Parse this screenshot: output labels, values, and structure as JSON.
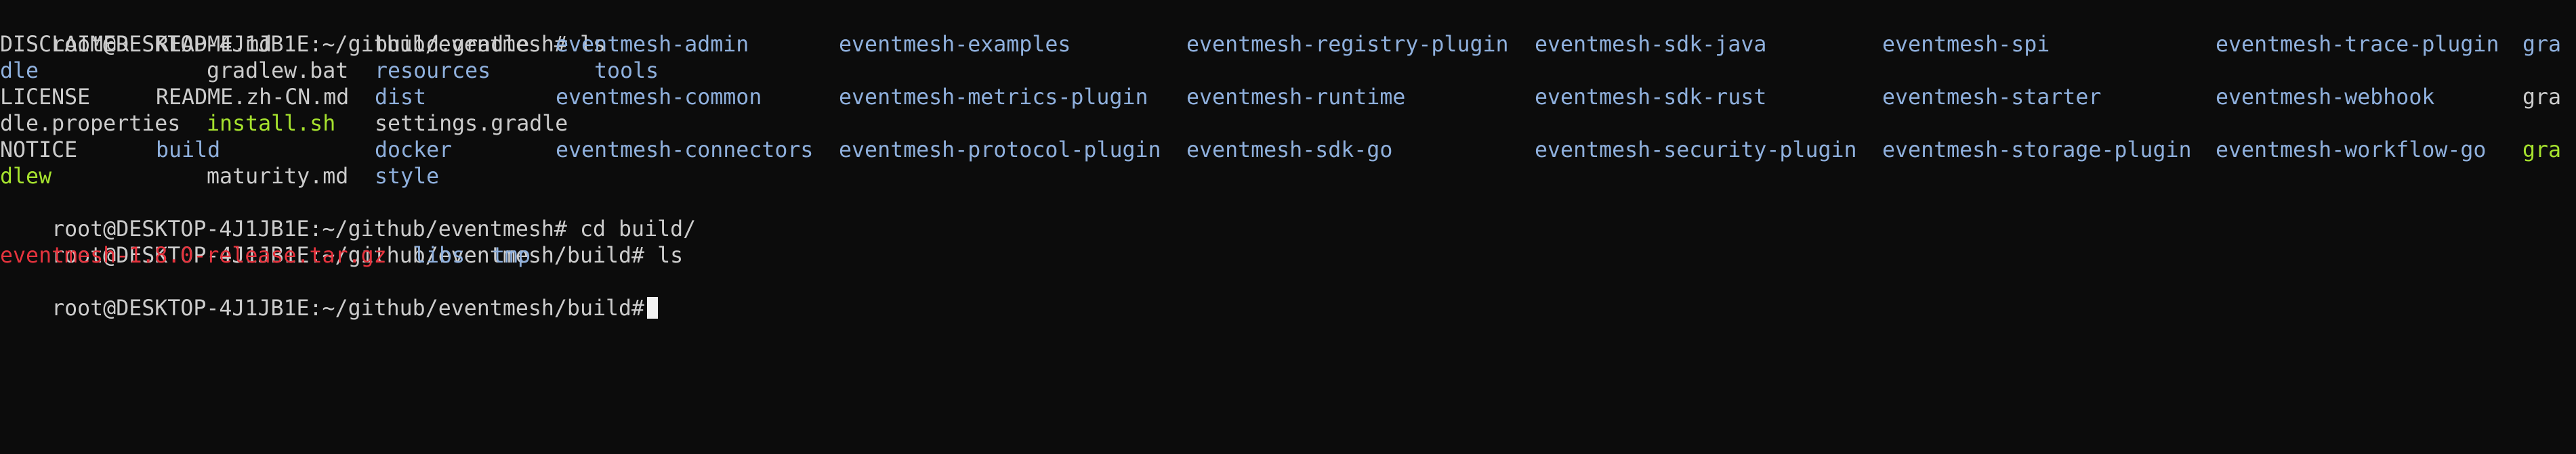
{
  "prompt_text": "root@DESKTOP-4J1JB1E:~/github/eventmesh#",
  "prompt_build": "root@DESKTOP-4J1JB1E:~/github/eventmesh/build#",
  "cmd_ls": " ls",
  "cmd_cd": " cd build/",
  "colors": {
    "background": "#0c0c0c",
    "plain": "#cccccc",
    "directory": "#8fb0dd",
    "executable": "#a6e22e",
    "archive": "#e5333d"
  },
  "ls_output": {
    "row1": [
      "DISCLAIMER",
      "README.md",
      "build.gradle",
      "eventmesh-admin",
      "eventmesh-examples",
      "eventmesh-registry-plugin",
      "eventmesh-sdk-java",
      "eventmesh-spi",
      "eventmesh-trace-plugin",
      "gra"
    ],
    "row2": [
      "dle",
      "gradlew.bat",
      "resources",
      "tools"
    ],
    "row3": [
      "LICENSE",
      "README.zh-CN.md",
      "dist",
      "eventmesh-common",
      "eventmesh-metrics-plugin",
      "eventmesh-runtime",
      "eventmesh-sdk-rust",
      "eventmesh-starter",
      "eventmesh-webhook",
      "gra"
    ],
    "row4": [
      "dle.properties",
      "install.sh",
      "settings.gradle"
    ],
    "row5": [
      "NOTICE",
      "build",
      "docker",
      "eventmesh-connectors",
      "eventmesh-protocol-plugin",
      "eventmesh-sdk-go",
      "eventmesh-security-plugin",
      "eventmesh-storage-plugin",
      "eventmesh-workflow-go",
      "gra"
    ],
    "row6": [
      "dlew",
      "maturity.md",
      "style"
    ]
  },
  "build_ls_output": [
    "eventmesh-1.8.0-release.tar.gz",
    "libs",
    "tmp"
  ]
}
